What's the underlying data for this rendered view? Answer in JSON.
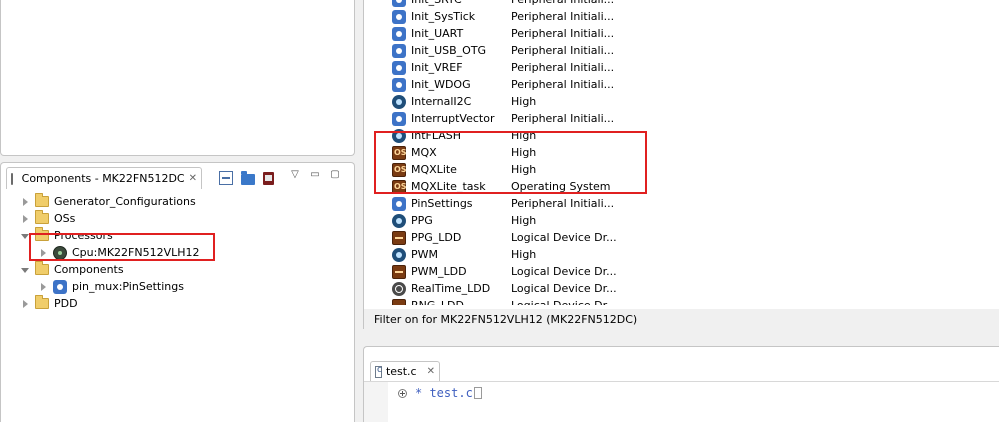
{
  "components_view": {
    "tab_title": "Components - MK22FN512DC",
    "tab_close": "✕",
    "view_menu": "▽",
    "minimize": "▭",
    "maximize": "▢",
    "tree": [
      {
        "label": "Generator_Configurations",
        "icon": "folder-icon",
        "expanded": false,
        "depth": 0
      },
      {
        "label": "OSs",
        "icon": "folder-icon",
        "expanded": false,
        "depth": 0
      },
      {
        "label": "Processors",
        "icon": "folder-icon",
        "expanded": true,
        "depth": 0
      },
      {
        "label": "Cpu:MK22FN512VLH12",
        "icon": "cpu-icon",
        "expanded": false,
        "depth": 1
      },
      {
        "label": "Components",
        "icon": "folder-icon",
        "expanded": true,
        "depth": 0
      },
      {
        "label": "pin_mux:PinSettings",
        "icon": "gear-icon",
        "expanded": false,
        "depth": 1
      },
      {
        "label": "PDD",
        "icon": "folder-icon",
        "expanded": false,
        "depth": 0
      }
    ]
  },
  "component_list": {
    "rows": [
      {
        "name": "Init_SRTC",
        "category": "Peripheral Initiali...",
        "icon": "init-icon"
      },
      {
        "name": "Init_SysTick",
        "category": "Peripheral Initiali...",
        "icon": "init-icon"
      },
      {
        "name": "Init_UART",
        "category": "Peripheral Initiali...",
        "icon": "init-icon"
      },
      {
        "name": "Init_USB_OTG",
        "category": "Peripheral Initiali...",
        "icon": "init-icon"
      },
      {
        "name": "Init_VREF",
        "category": "Peripheral Initiali...",
        "icon": "init-icon"
      },
      {
        "name": "Init_WDOG",
        "category": "Peripheral Initiali...",
        "icon": "init-icon"
      },
      {
        "name": "InternalI2C",
        "category": "High",
        "icon": "high-level-icon"
      },
      {
        "name": "InterruptVector",
        "category": "Peripheral Initiali...",
        "icon": "init-icon"
      },
      {
        "name": "IntFLASH",
        "category": "High",
        "icon": "high-level-icon"
      },
      {
        "name": "MQX",
        "category": "High",
        "icon": "os-icon"
      },
      {
        "name": "MQXLite",
        "category": "High",
        "icon": "os-icon"
      },
      {
        "name": "MQXLite_task",
        "category": "Operating System",
        "icon": "os-icon"
      },
      {
        "name": "PinSettings",
        "category": "Peripheral Initiali...",
        "icon": "init-icon"
      },
      {
        "name": "PPG",
        "category": "High",
        "icon": "high-level-icon"
      },
      {
        "name": "PPG_LDD",
        "category": "Logical Device Dr...",
        "icon": "ldd-icon"
      },
      {
        "name": "PWM",
        "category": "High",
        "icon": "high-level-icon"
      },
      {
        "name": "PWM_LDD",
        "category": "Logical Device Dr...",
        "icon": "ldd-icon"
      },
      {
        "name": "RealTime_LDD",
        "category": "Logical Device Dr...",
        "icon": "realtime-icon"
      },
      {
        "name": "RNG_LDD",
        "category": "Logical Device Dr...",
        "icon": "ldd-icon"
      }
    ],
    "filter_text": "Filter on for MK22FN512VLH12 (MK22FN512DC)"
  },
  "editor": {
    "tab_title": "test.c",
    "tab_close": "✕",
    "code_line": "* test.c"
  },
  "colors": {
    "highlight": "#e02020",
    "panel_border": "#c5c5c5"
  }
}
